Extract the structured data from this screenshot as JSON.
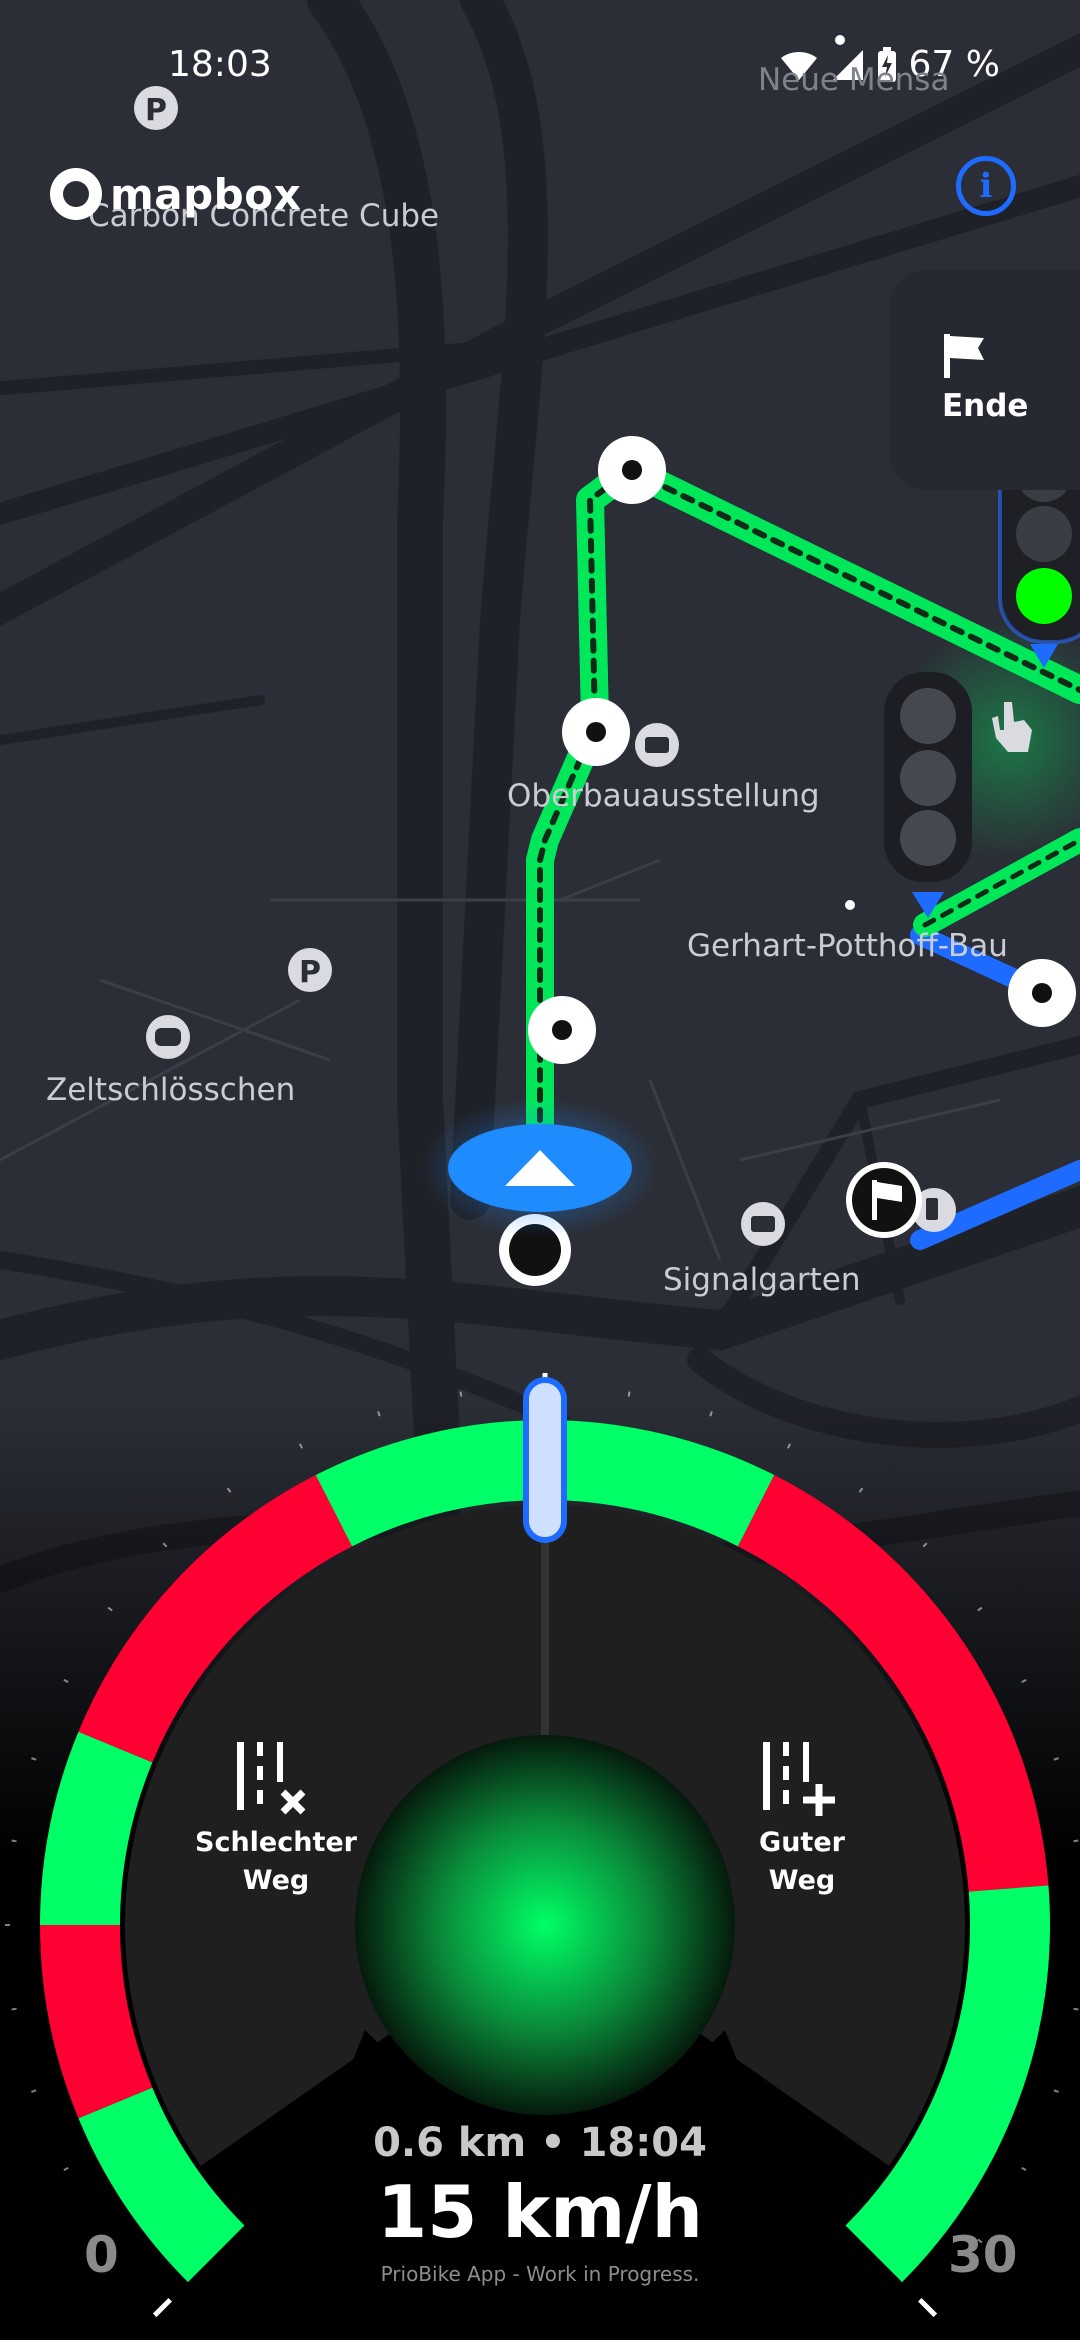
{
  "status_bar": {
    "time": "18:03",
    "battery": "67 %"
  },
  "map": {
    "attribution": "mapbox",
    "labels": {
      "carbon_concrete_cube": "Carbon Concrete Cube",
      "neue_mensa": "Neue Mensa",
      "oberbauausstellung": "Oberbauausstellung",
      "gerhart_potthoff_bau": "Gerhart-Potthoff-Bau",
      "zeltschloesschen": "Zeltschlösschen",
      "signalgarten": "Signalgarten"
    },
    "route_color": "#00ff66",
    "alt_route_color": "#1e6bff"
  },
  "controls": {
    "info_icon": "info-icon",
    "end_button_label": "Ende"
  },
  "traffic_lights": {
    "active_light": "green",
    "active_color": "#00ff00"
  },
  "feedback": {
    "bad_path_label": "Schlechter Weg",
    "bad_path_line1": "Schlechter",
    "bad_path_line2": "Weg",
    "good_path_label": "Guter Weg",
    "good_path_line1": "Guter",
    "good_path_line2": "Weg"
  },
  "speedometer": {
    "min_label": "0",
    "max_label": "30",
    "speed_range": [
      0,
      30
    ],
    "current_speed": 15,
    "current_speed_label": "15 km/h",
    "segments": [
      {
        "from": 0,
        "to": 2.5,
        "color": "#00ff66"
      },
      {
        "from": 2.5,
        "to": 5,
        "color": "#ff0033"
      },
      {
        "from": 5,
        "to": 7.5,
        "color": "#00ff66"
      },
      {
        "from": 7.5,
        "to": 12,
        "color": "#ff0033"
      },
      {
        "from": 12,
        "to": 18,
        "color": "#00ff66"
      },
      {
        "from": 18,
        "to": 24.5,
        "color": "#ff0033"
      },
      {
        "from": 24.5,
        "to": 30,
        "color": "#00ff66"
      }
    ],
    "signal_color": "#00ff66"
  },
  "trip": {
    "distance_eta": "0.6 km • 18:04"
  },
  "footer": {
    "note": "PrioBike App - Work in Progress."
  }
}
